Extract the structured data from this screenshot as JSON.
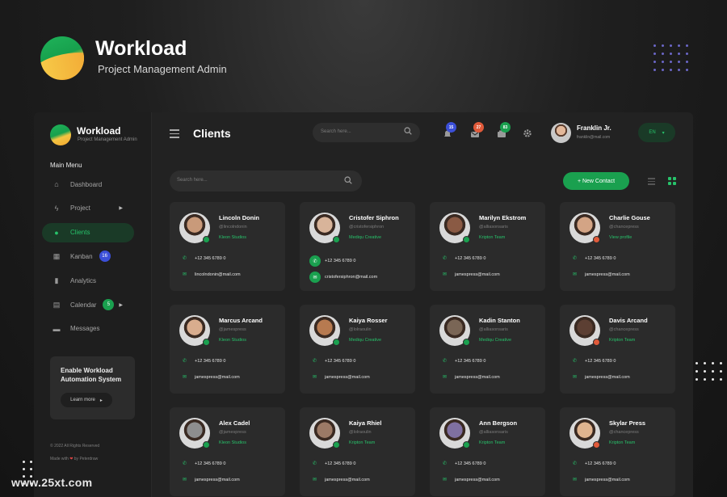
{
  "hero": {
    "title": "Workload",
    "subtitle": "Project Management Admin"
  },
  "watermark": "www.25xt.com",
  "sidebar": {
    "title": "Workload",
    "subtitle": "Project Management Admin",
    "menu_heading": "Main Menu",
    "items": [
      {
        "label": "Dashboard",
        "icon": "home-icon"
      },
      {
        "label": "Project",
        "icon": "bolt-icon",
        "has_arrow": true
      },
      {
        "label": "Clients",
        "icon": "user-icon",
        "active": true
      },
      {
        "label": "Kanban",
        "icon": "grid-icon",
        "badge": "16",
        "badge_color": "#3b4fd8"
      },
      {
        "label": "Analytics",
        "icon": "bar-chart-icon"
      },
      {
        "label": "Calendar",
        "icon": "calendar-icon",
        "badge": "5",
        "badge_color": "#1aa04f",
        "has_arrow": true
      },
      {
        "label": "Messages",
        "icon": "chat-icon"
      }
    ],
    "promo": {
      "text": "Enable Workload Automation System",
      "button": "Learn more"
    },
    "copyright": "© 2022 All Rights Reserved",
    "made_prefix": "Made with",
    "made_suffix": "by Peterdraw"
  },
  "header": {
    "page_title": "Clients",
    "search_placeholder": "Search here...",
    "notifications": [
      {
        "icon": "bell-icon",
        "count": "15",
        "color": "#3b4fd8"
      },
      {
        "icon": "mail-icon",
        "count": "27",
        "color": "#e05a3a"
      },
      {
        "icon": "inbox-icon",
        "count": "83",
        "color": "#1aa04f"
      }
    ],
    "settings_icon": "gear-icon",
    "user": {
      "name": "Franklin Jr.",
      "email": "franklin@mail.com"
    },
    "language": "EN"
  },
  "toolbar": {
    "search_placeholder": "Search here...",
    "new_contact": "+ New Contact"
  },
  "colors": {
    "accent": "#1aa04f",
    "online": "#1aa04f",
    "offline": "#e05a3a"
  },
  "clients": [
    {
      "name": "Lincoln Donin",
      "handle": "@lincolndonin",
      "company": "Kleon Studios",
      "phone": "+12 345 6789 0",
      "email": "lincolndonin@mail.com",
      "status": "online",
      "highlight": false,
      "avatar": "#c99a7a"
    },
    {
      "name": "Cristofer Siphron",
      "handle": "@cristofersiphron",
      "company": "Mediqu Creative",
      "phone": "+12 345 6789 0",
      "email": "cristofersiphron@mail.com",
      "status": "online",
      "highlight": true,
      "avatar": "#d8b49a"
    },
    {
      "name": "Marilyn Ekstrom",
      "handle": "@alliasonsaris",
      "company": "Kripton Team",
      "phone": "+12 345 6789 0",
      "email": "jamespress@mail.com",
      "status": "online",
      "highlight": false,
      "avatar": "#8a5a44"
    },
    {
      "name": "Charlie Gouse",
      "handle": "@chancepress",
      "company": "View profile",
      "phone": "+12 345 6789 0",
      "email": "jamespress@mail.com",
      "status": "offline",
      "highlight": false,
      "avatar": "#d3a485"
    },
    {
      "name": "Marcus  Arcand",
      "handle": "@jamespress",
      "company": "Kleon Studios",
      "phone": "+12 345 6789 0",
      "email": "jamespress@mail.com",
      "status": "online",
      "highlight": false,
      "avatar": "#d9ad8e"
    },
    {
      "name": "Kaiya Rosser",
      "handle": "@lolraoulin",
      "company": "Mediqu Creative",
      "phone": "+12 345 6789 0",
      "email": "jamespress@mail.com",
      "status": "online",
      "highlight": false,
      "avatar": "#b77a50"
    },
    {
      "name": "Kadin Stanton",
      "handle": "@alliasonsaris",
      "company": "Mediqu Creative",
      "phone": "+12 345 6789 0",
      "email": "jamespress@mail.com",
      "status": "online",
      "highlight": false,
      "avatar": "#7a6656"
    },
    {
      "name": "Davis Arcand",
      "handle": "@chancepress",
      "company": "Kripton Team",
      "phone": "+12 345 6789 0",
      "email": "jamespress@mail.com",
      "status": "offline",
      "highlight": false,
      "avatar": "#5c3f33"
    },
    {
      "name": "Alex Cadel",
      "handle": "@jamespress",
      "company": "Kleon Studios",
      "phone": "+12 345 6789 0",
      "email": "jamespress@mail.com",
      "status": "online",
      "highlight": false,
      "avatar": "#8e8e8e"
    },
    {
      "name": "Kaiya Rhiel",
      "handle": "@lolraoulin",
      "company": "Kripton Team",
      "phone": "+12 345 6789 0",
      "email": "jamespress@mail.com",
      "status": "online",
      "highlight": false,
      "avatar": "#9c7a66"
    },
    {
      "name": "Ann Bergson",
      "handle": "@alliasonsaris",
      "company": "Kripton Team",
      "phone": "+12 345 6789 0",
      "email": "jamespress@mail.com",
      "status": "online",
      "highlight": false,
      "avatar": "#8070a0"
    },
    {
      "name": "Skylar Press",
      "handle": "@chancepress",
      "company": "Kripton Team",
      "phone": "+12 345 6789 0",
      "email": "jamespress@mail.com",
      "status": "offline",
      "highlight": false,
      "avatar": "#e0b48f"
    }
  ]
}
